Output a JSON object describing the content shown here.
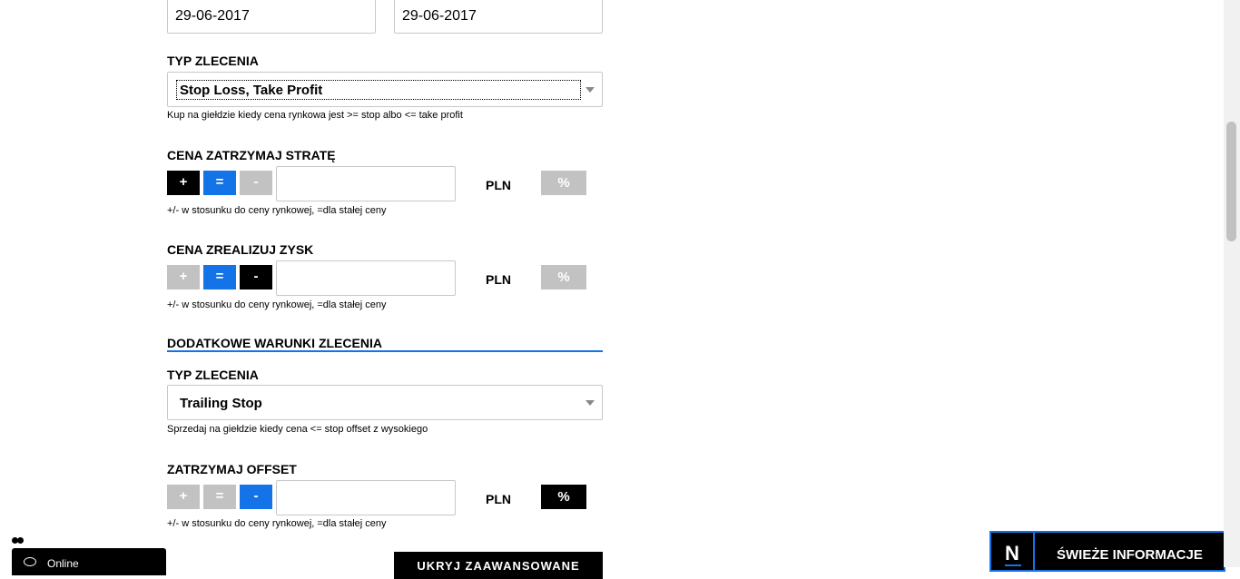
{
  "dates": {
    "from": "29-06-2017",
    "to": "29-06-2017"
  },
  "order_type": {
    "label": "TYP ZLECENIA",
    "value": "Stop Loss, Take Profit",
    "help": "Kup na giełdzie kiedy cena rynkowa jest >= stop albo <= take profit"
  },
  "stop_loss": {
    "label": "CENA ZATRZYMAJ STRATĘ",
    "plus": "+",
    "equals": "=",
    "minus": "-",
    "value": "",
    "currency": "PLN",
    "percent": "%",
    "help": "+/- w stosunku do ceny rynkowej, =dla stałej ceny"
  },
  "take_profit": {
    "label": "CENA ZREALIZUJ ZYSK",
    "plus": "+",
    "equals": "=",
    "minus": "-",
    "value": "",
    "currency": "PLN",
    "percent": "%",
    "help": "+/- w stosunku do ceny rynkowej, =dla stałej ceny"
  },
  "extra": {
    "heading": "DODATKOWE WARUNKI ZLECENIA",
    "type_label": "TYP ZLECENIA",
    "type_value": "Trailing Stop",
    "type_help": "Sprzedaj na giełdzie kiedy cena <= stop offset z wysokiego"
  },
  "offset": {
    "label": "ZATRZYMAJ OFFSET",
    "plus": "+",
    "equals": "=",
    "minus": "-",
    "value": "",
    "currency": "PLN",
    "percent": "%",
    "help": "+/- w stosunku do ceny rynkowej, =dla stałej ceny"
  },
  "hide_advanced_button": "UKRYJ ZAAWANSOWANE",
  "chat": {
    "status": "Online"
  },
  "news": {
    "logo": "N",
    "label": "ŚWIEŻE INFORMACJE"
  },
  "colors": {
    "accent": "#1473e6",
    "active": "#000000",
    "inactive": "#c2c2c2"
  }
}
